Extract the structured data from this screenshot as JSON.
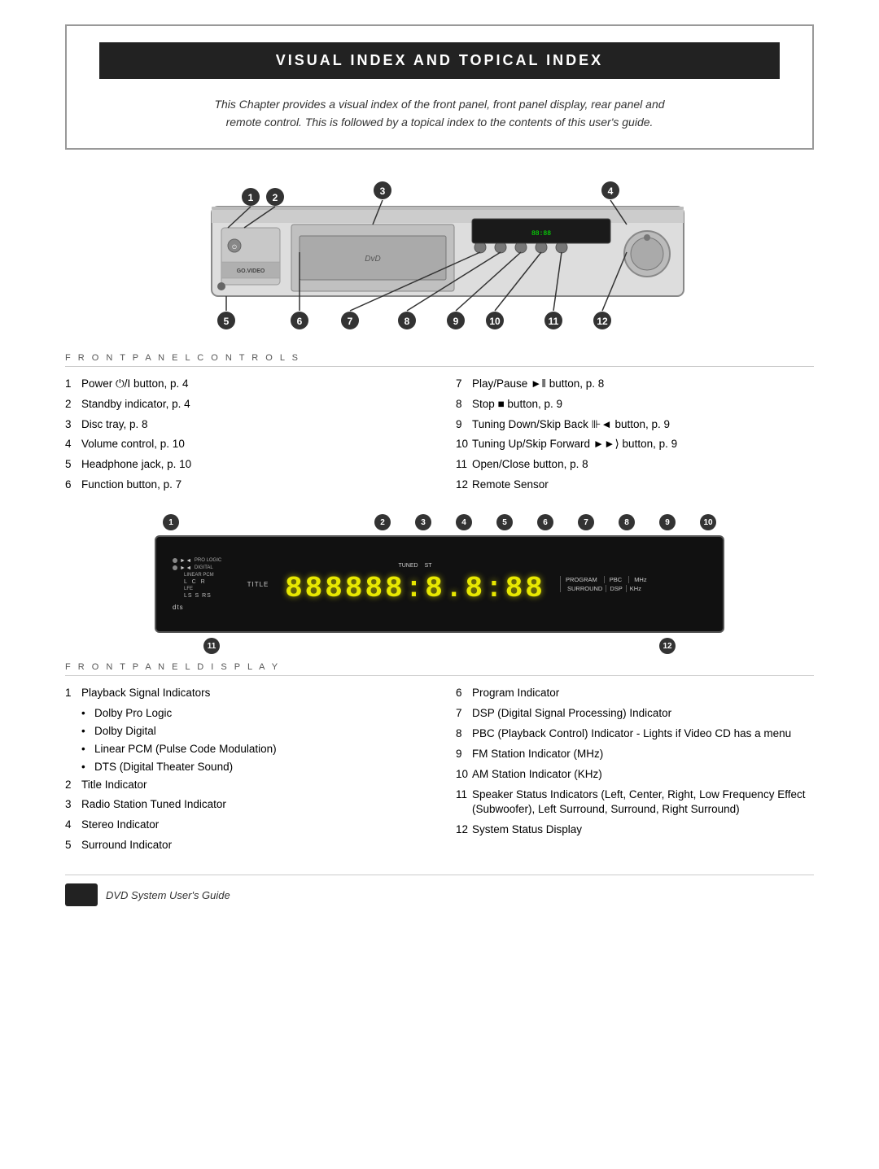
{
  "chapter": {
    "header_text": "VISUAL INDEX AND TOPICAL INDEX",
    "subtitle_line1": "This Chapter provides a visual index of the front panel, front panel display, rear panel and",
    "subtitle_line2": "remote control. This is followed by a topical index to the contents of this user's guide."
  },
  "front_panel_controls": {
    "section_title": "F R O N T   P A N E L   C O N T R O L S",
    "left_items": [
      {
        "num": "1",
        "text": "Power ⏻/I button, p. 4"
      },
      {
        "num": "2",
        "text": "Standby indicator, p. 4"
      },
      {
        "num": "3",
        "text": "Disc tray, p. 8"
      },
      {
        "num": "4",
        "text": "Volume control, p. 10"
      },
      {
        "num": "5",
        "text": "Headphone jack, p. 10"
      },
      {
        "num": "6",
        "text": "Function button, p. 7"
      }
    ],
    "right_items": [
      {
        "num": "7",
        "text": "Play/Pause ►‖ button, p. 8"
      },
      {
        "num": "8",
        "text": "Stop ■ button, p. 9"
      },
      {
        "num": "9",
        "text": "Tuning Down/Skip Back ⧏◄ button, p. 9"
      },
      {
        "num": "10",
        "text": "Tuning Up/Skip Forward ►▶⦉ button, p. 9"
      },
      {
        "num": "11",
        "text": "Open/Close button, p. 8"
      },
      {
        "num": "12",
        "text": "Remote Sensor"
      }
    ]
  },
  "front_panel_display": {
    "section_title": "F R O N T   P A N E L   D I S P L A Y",
    "display_digits": "888888:8.8:88",
    "display_top_labels": [
      "TUNED",
      "ST",
      "PROGRAM",
      "PBC",
      "MHz"
    ],
    "display_sub_labels": [
      "SURROUND",
      "DSP",
      "KHz"
    ],
    "left_indicators": {
      "rows": [
        {
          "sym": "▶◄",
          "label": "PRO LOGIC"
        },
        {
          "sym": "▶◄",
          "label": "DIGITAL"
        },
        {
          "label": "LINEAR PCM"
        },
        {
          "sub": "L  C  R"
        },
        {
          "label": "LFE"
        },
        {
          "sub": "LS  S  RS"
        }
      ]
    },
    "left_items": [
      {
        "num": "1",
        "text": "Playback Signal Indicators"
      },
      {
        "sub_bullets": [
          "Dolby Pro Logic",
          "Dolby Digital",
          "Linear PCM (Pulse Code Modulation)",
          "DTS (Digital Theater Sound)"
        ]
      },
      {
        "num": "2",
        "text": "Title Indicator"
      },
      {
        "num": "3",
        "text": "Radio Station Tuned Indicator"
      },
      {
        "num": "4",
        "text": "Stereo Indicator"
      },
      {
        "num": "5",
        "text": "Surround Indicator"
      }
    ],
    "right_items": [
      {
        "num": "6",
        "text": "Program Indicator"
      },
      {
        "num": "7",
        "text": "DSP (Digital Signal Processing) Indicator"
      },
      {
        "num": "8",
        "text": "PBC (Playback Control) Indicator - Lights if Video CD has a menu"
      },
      {
        "num": "9",
        "text": "FM Station Indicator (MHz)"
      },
      {
        "num": "10",
        "text": "AM Station Indicator (KHz)"
      },
      {
        "num": "11",
        "text": "Speaker Status Indicators (Left, Center, Right, Low Frequency Effect (Subwoofer), Left Surround, Surround, Right Surround)"
      },
      {
        "num": "12",
        "text": "System Status Display"
      }
    ]
  },
  "footer": {
    "text": "DVD System User's Guide"
  },
  "callout_labels": {
    "c1": "1",
    "c2": "2",
    "c3": "3",
    "c4": "4",
    "c5": "5",
    "c6": "6",
    "c7": "7",
    "c8": "8",
    "c9": "9",
    "c10": "10",
    "c11": "11",
    "c12": "12"
  }
}
